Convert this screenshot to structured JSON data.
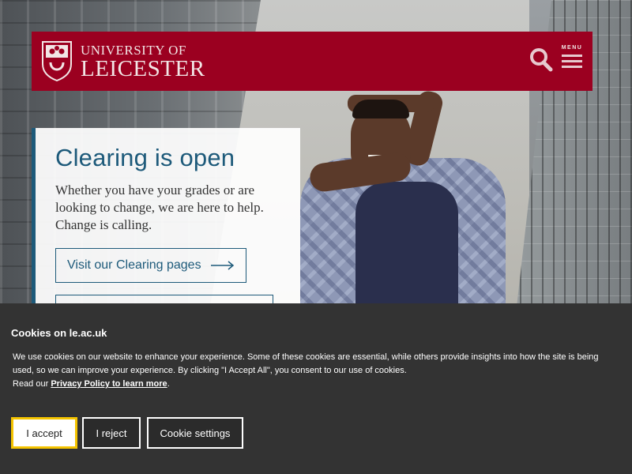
{
  "header": {
    "logo_line1": "UNIVERSITY OF",
    "logo_line2": "LEICESTER",
    "menu_label": "MENU",
    "brand_color": "#9b0020"
  },
  "hero": {
    "title": "Clearing is open",
    "body": "Whether you have your grades or are looking to change, we are here to help. Change is calling.",
    "primary_button": "Visit our Clearing pages",
    "accent_color": "#1d5a7a"
  },
  "cookie_banner": {
    "title": "Cookies on le.ac.uk",
    "message": "We use cookies on our website to enhance your experience. Some of these cookies are essential, while others provide insights into how the site is being used, so we can improve your experience. By clicking \"I Accept All\", you consent to our use of cookies.",
    "read_our": "Read our",
    "privacy_link": "Privacy Policy to learn more",
    "period": ".",
    "accept_label": "I accept",
    "reject_label": "I reject",
    "settings_label": "Cookie settings",
    "focus_color": "#f5c400"
  },
  "icons": {
    "search": "search-icon",
    "menu": "hamburger-menu-icon",
    "arrow": "arrow-right-icon",
    "crest": "university-crest-icon"
  }
}
